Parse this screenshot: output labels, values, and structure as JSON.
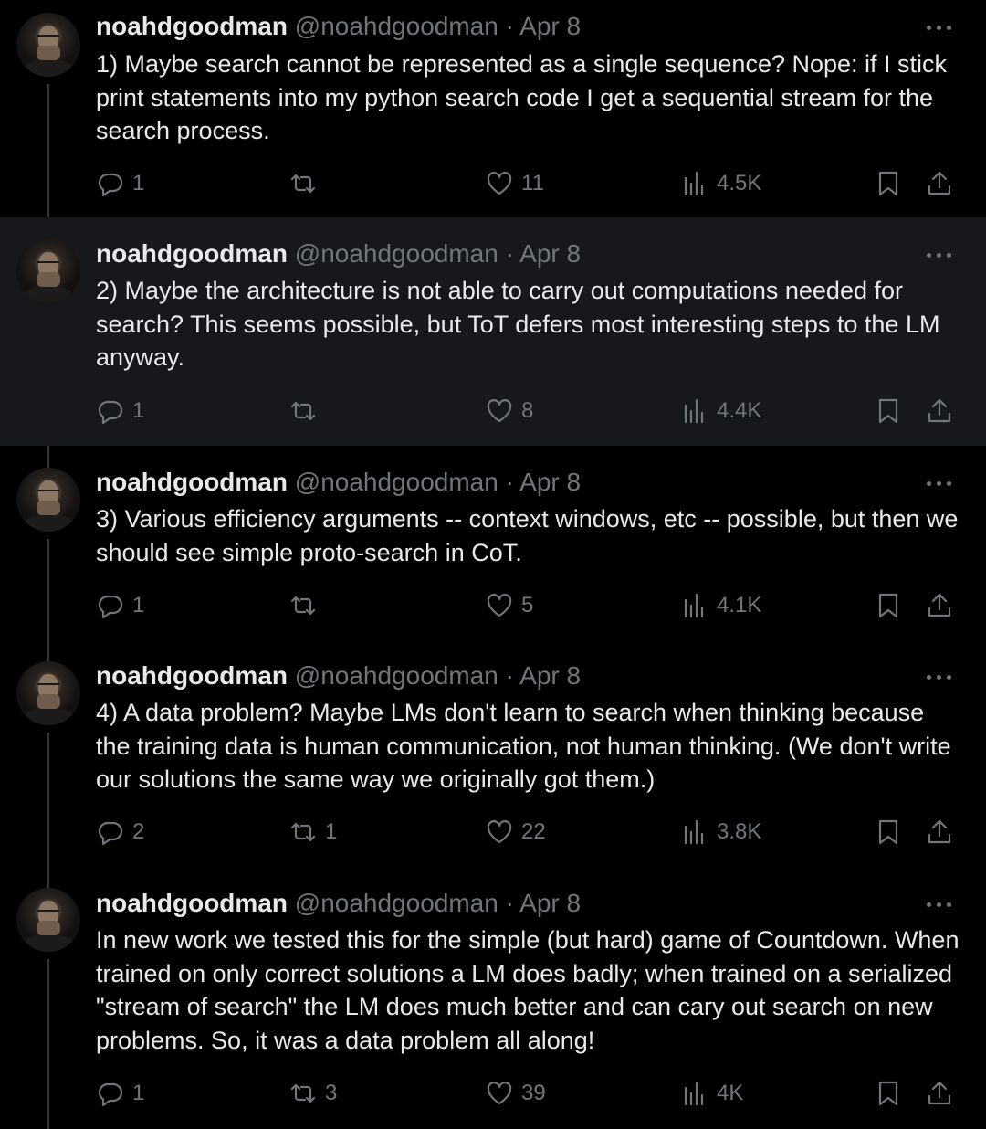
{
  "tweets": [
    {
      "name": "noahdgoodman",
      "meta": "@noahdgoodman · Apr 8",
      "text": "1) Maybe search cannot be represented as a single sequence? Nope: if I stick print statements into my python search code I get a sequential stream for the search process.",
      "replies": "1",
      "retweets": "",
      "likes": "11",
      "views": "4.5K"
    },
    {
      "name": "noahdgoodman",
      "meta": "@noahdgoodman · Apr 8",
      "text": "2) Maybe the architecture is not able to carry out computations needed for search? This seems possible, but ToT defers most interesting steps to the LM anyway.",
      "replies": "1",
      "retweets": "",
      "likes": "8",
      "views": "4.4K"
    },
    {
      "name": "noahdgoodman",
      "meta": "@noahdgoodman · Apr 8",
      "text": "3) Various efficiency arguments -- context windows, etc -- possible, but then we should see simple proto-search in CoT.",
      "replies": "1",
      "retweets": "",
      "likes": "5",
      "views": "4.1K"
    },
    {
      "name": "noahdgoodman",
      "meta": "@noahdgoodman · Apr 8",
      "text": "4) A data problem? Maybe LMs don't learn to search when thinking because the training data is human communication, not human thinking. (We don't write our solutions the same way we originally got them.)",
      "replies": "2",
      "retweets": "1",
      "likes": "22",
      "views": "3.8K"
    },
    {
      "name": "noahdgoodman",
      "meta": "@noahdgoodman · Apr 8",
      "text": "In new work we tested this for the simple (but hard) game of Countdown. When trained on only correct solutions a LM does badly; when trained on a serialized \"stream of search\" the LM does much better and can cary out search on new problems. So, it was a data problem all along!",
      "replies": "1",
      "retweets": "3",
      "likes": "39",
      "views": "4K"
    }
  ],
  "icons": {
    "reply": "reply-icon",
    "retweet": "retweet-icon",
    "like": "heart-icon",
    "views": "views-icon",
    "bookmark": "bookmark-icon",
    "share": "share-icon",
    "more": "more-icon"
  },
  "colors": {
    "background": "#000000",
    "highlight_background": "#16181c",
    "text": "#e7e9ea",
    "secondary_text": "#71767b",
    "thread_line": "#333639"
  }
}
